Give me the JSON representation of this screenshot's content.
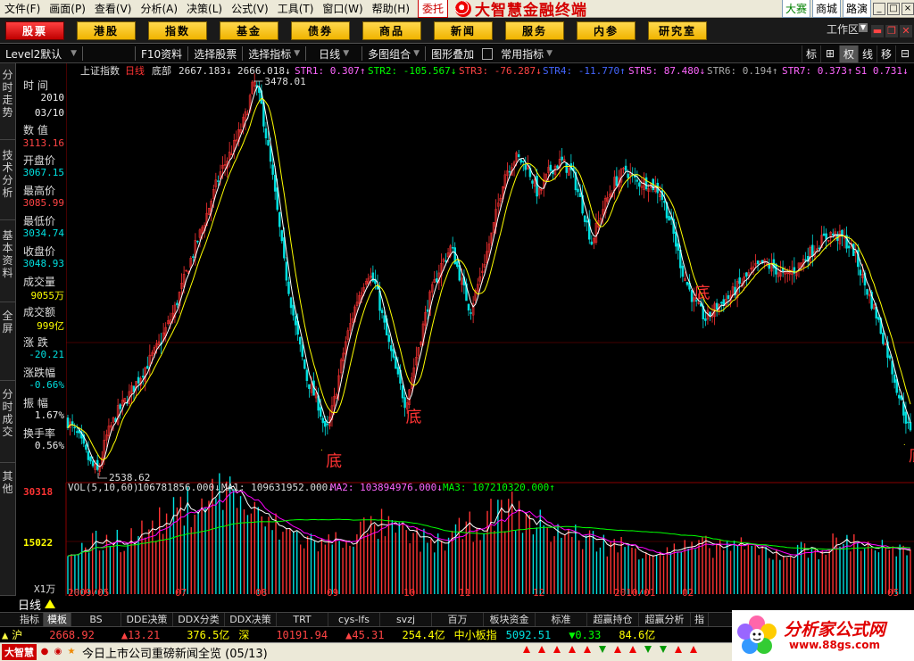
{
  "menu": {
    "items": [
      "文件(F)",
      "画面(P)",
      "查看(V)",
      "分析(A)",
      "决策(L)",
      "公式(V)",
      "工具(T)",
      "窗口(W)",
      "帮助(H)"
    ],
    "entrust_label": "委托",
    "brand_title": "大智慧金融终端",
    "right_tabs": [
      "大赛",
      "商城",
      "路演"
    ],
    "window_controls": [
      "_",
      "□",
      "×"
    ]
  },
  "nav": {
    "buttons": [
      "股票",
      "港股",
      "指数",
      "基金",
      "债券",
      "商品",
      "新闻",
      "服务",
      "内参",
      "研究室"
    ],
    "active_index": 0,
    "workarea_label": "工作区"
  },
  "toolbar": {
    "level2_label": "Level2默认",
    "f10_label": "F10资料",
    "select_stock_label": "选择股票",
    "select_indicator_label": "选择指标",
    "daily_label": "日线",
    "multichart_label": "多图组合",
    "overlay_label": "图形叠加",
    "common_indicator_label": "常用指标",
    "right_buttons": [
      "标",
      "⊞",
      "权",
      "线",
      "移",
      "⊟"
    ]
  },
  "left_tabs": [
    "分时走势",
    "技术分析",
    "基本资料",
    "全屏",
    "分时成交",
    "其他"
  ],
  "info_panel": {
    "time_label": "时 间",
    "date_year": "2010",
    "date_md": "03/10",
    "value_label": "数 值",
    "value": "3113.16",
    "open_label": "开盘价",
    "open": "3067.15",
    "high_label": "最高价",
    "high": "3085.99",
    "low_label": "最低价",
    "low": "3034.74",
    "close_label": "收盘价",
    "close": "3048.93",
    "volume_label": "成交量",
    "volume": "9055万",
    "amount_label": "成交额",
    "amount": "999亿",
    "change_label": "涨 跌",
    "change": "-20.21",
    "change_pct_label": "涨跌幅",
    "change_pct": "-0.66%",
    "amplitude_label": "振 幅",
    "amplitude": "1.67%",
    "turnover_label": "换手率",
    "turnover": "0.56%"
  },
  "chart_header": {
    "index_name": "上证指数",
    "period": "日线",
    "formula": "底部",
    "v1": "2667.183↓",
    "v2": "2666.018↓",
    "str1": "STR1: 0.307↑",
    "str2": "STR2: -105.567↓",
    "str3": "STR3: -76.287↓",
    "str4": "STR4: -11.770↑",
    "str5": "STR5: 87.480↓",
    "str6": "STR6: 0.194↑",
    "str7": "STR7: 0.373↑",
    "s1": "S1 0.731↓"
  },
  "volume_header": {
    "name": "VOL(5,10,60)",
    "vol": "106781856.000↓",
    "ma1": "MA1: 109631952.000↓",
    "ma2": "MA2: 103894976.000↓",
    "ma3": "MA3: 107210320.000↑"
  },
  "axis": {
    "price_top": "3478",
    "price_bottom": "2539",
    "peak_annotation": "3478.01",
    "trough_annotation": "2538.62",
    "vol_top": "30318",
    "vol_mid": "15022",
    "vol_unit": "X1万",
    "months": [
      "2009/05",
      "07",
      "08",
      "09",
      "10",
      "11",
      "12",
      "2010/01",
      "02",
      "05"
    ],
    "bottom_markers": [
      "底",
      "底",
      "底",
      "底"
    ]
  },
  "chart_data": {
    "type": "line",
    "title": "上证指数 日线",
    "ylim": [
      2538.62,
      3478.01
    ],
    "price_series_name": "上证指数",
    "price_points": [
      [
        0,
        2680
      ],
      [
        3,
        2640
      ],
      [
        6,
        2580
      ],
      [
        8,
        2560
      ],
      [
        10,
        2640
      ],
      [
        13,
        2700
      ],
      [
        16,
        2740
      ],
      [
        20,
        2800
      ],
      [
        24,
        2860
      ],
      [
        28,
        2940
      ],
      [
        32,
        3050
      ],
      [
        36,
        3150
      ],
      [
        40,
        3260
      ],
      [
        44,
        3330
      ],
      [
        47,
        3400
      ],
      [
        49,
        3478
      ],
      [
        51,
        3420
      ],
      [
        54,
        3250
      ],
      [
        57,
        3050
      ],
      [
        60,
        2900
      ],
      [
        63,
        2780
      ],
      [
        66,
        2720
      ],
      [
        68,
        2650
      ],
      [
        70,
        2720
      ],
      [
        73,
        2860
      ],
      [
        76,
        2960
      ],
      [
        79,
        3030
      ],
      [
        81,
        3000
      ],
      [
        84,
        2880
      ],
      [
        87,
        2780
      ],
      [
        89,
        2720
      ],
      [
        92,
        2840
      ],
      [
        95,
        2960
      ],
      [
        98,
        3040
      ],
      [
        101,
        3090
      ],
      [
        104,
        3000
      ],
      [
        106,
        2940
      ],
      [
        109,
        3030
      ],
      [
        112,
        3130
      ],
      [
        115,
        3260
      ],
      [
        118,
        3300
      ],
      [
        121,
        3280
      ],
      [
        124,
        3210
      ],
      [
        127,
        3270
      ],
      [
        130,
        3290
      ],
      [
        133,
        3260
      ],
      [
        136,
        3170
      ],
      [
        138,
        3100
      ],
      [
        141,
        3180
      ],
      [
        144,
        3240
      ],
      [
        147,
        3270
      ],
      [
        150,
        3240
      ],
      [
        153,
        3240
      ],
      [
        156,
        3220
      ],
      [
        159,
        3140
      ],
      [
        162,
        3030
      ],
      [
        165,
        2960
      ],
      [
        168,
        2920
      ],
      [
        171,
        2950
      ],
      [
        174,
        2970
      ],
      [
        177,
        3000
      ],
      [
        180,
        3030
      ],
      [
        183,
        3050
      ],
      [
        186,
        3040
      ],
      [
        189,
        3020
      ],
      [
        192,
        3040
      ],
      [
        195,
        3070
      ],
      [
        198,
        3100
      ],
      [
        201,
        3120
      ],
      [
        204,
        3110
      ],
      [
        207,
        3080
      ],
      [
        210,
        3000
      ],
      [
        213,
        2930
      ],
      [
        216,
        2840
      ],
      [
        219,
        2740
      ],
      [
        222,
        2650
      ]
    ],
    "volume_values": [
      12000,
      13000,
      14500,
      16000,
      15500,
      17000,
      19000,
      21000,
      24000,
      26000,
      28000,
      30318,
      27000,
      22000,
      20000,
      18000,
      16500,
      15000,
      14000,
      15500,
      17000,
      18500,
      19500,
      17500,
      16000,
      15000,
      14500,
      16500,
      18500,
      20500,
      22500,
      24000,
      21500,
      19500,
      18000,
      17000,
      16000,
      15000,
      14000,
      13500,
      13000,
      12500,
      12000,
      12500,
      13000,
      13500,
      14000,
      13000,
      12500,
      12000,
      11500,
      12000,
      12500,
      13500,
      14500,
      15000,
      14000,
      13000,
      12000,
      11000
    ],
    "vol_ylim": [
      0,
      30318
    ],
    "ma_series_names": [
      "MA1",
      "MA2",
      "MA3"
    ]
  },
  "bottom_tabs": [
    "指标",
    "模板",
    "BS",
    "DDE决策",
    "DDX分类",
    "DDX决策",
    "TRT",
    "cys-lfs",
    "svzj",
    "百万",
    "板块资金",
    "标准",
    "超赢持仓",
    "超赢分析",
    "指"
  ],
  "period_strip": {
    "label": "日线"
  },
  "status_bar": {
    "sh_label": "沪",
    "sh_index": "2668.92",
    "sh_change": "▲13.21",
    "sh_amount": "376.5亿",
    "sz_label": "深",
    "sz_index": "10191.94",
    "sz_change": "▲45.31",
    "sz_amount": "254.4亿",
    "sme_label": "中小板指",
    "sme_index": "5092.51",
    "sme_change": "▼0.33",
    "sme_amount": "84.6亿"
  },
  "ticker": {
    "logo": "大智慧",
    "text": "今日上市公司重磅新闻全览 (05/13)"
  },
  "watermark": {
    "title": "分析家公式网",
    "url": "www.88gs.com"
  },
  "colors": {
    "up": "#ff3333",
    "down": "#00e0e0",
    "ma_white": "#ffffff",
    "ma_yellow": "#ffff00",
    "ma_magenta": "#ff00ff",
    "ma_green": "#00ff00",
    "grid_red": "#8a0000"
  }
}
